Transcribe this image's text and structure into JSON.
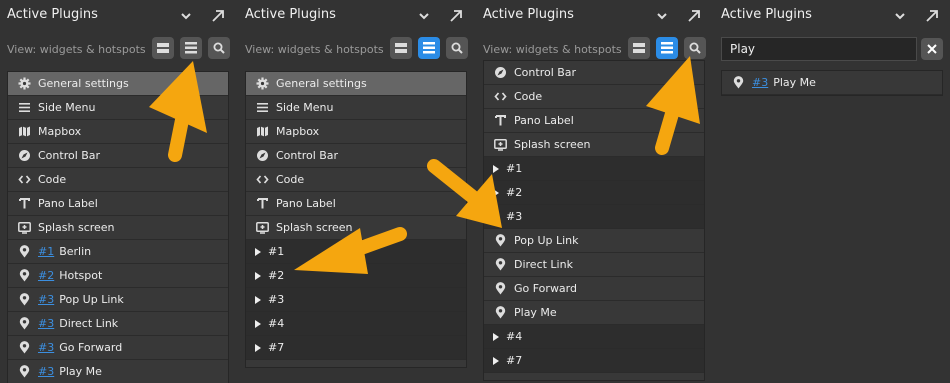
{
  "header": {
    "title": "Active Plugins"
  },
  "toolbar": {
    "view_label": "View: widgets & hotspots"
  },
  "search": {
    "value": "Play"
  },
  "icons": {
    "expand": "expand-arrow-icon",
    "chevron": "chevron-down-icon",
    "search": "search-icon",
    "collapse": "collapse-all-icon",
    "list": "expand-all-icon",
    "clear": "close-icon"
  },
  "colors": {
    "active_button": "#2b8ce6",
    "link": "#3c8fe0",
    "annotation_arrow": "#f5a60f",
    "selected_row": "#666666"
  },
  "panel1": {
    "items": [
      {
        "icon": "gear",
        "label": "General settings"
      },
      {
        "icon": "menu",
        "label": "Side Menu"
      },
      {
        "icon": "map",
        "label": "Mapbox"
      },
      {
        "icon": "compass",
        "label": "Control Bar"
      },
      {
        "icon": "code",
        "label": "Code"
      },
      {
        "icon": "text",
        "label": "Pano Label"
      },
      {
        "icon": "splash",
        "label": "Splash screen"
      },
      {
        "icon": "pin",
        "tag": "#1",
        "label": "Berlin"
      },
      {
        "icon": "pin",
        "tag": "#2",
        "label": "Hotspot"
      },
      {
        "icon": "pin",
        "tag": "#3",
        "label": "Pop Up Link"
      },
      {
        "icon": "pin",
        "tag": "#3",
        "label": "Direct Link"
      },
      {
        "icon": "pin",
        "tag": "#3",
        "label": "Go Forward"
      },
      {
        "icon": "pin",
        "tag": "#3",
        "label": "Play Me"
      }
    ]
  },
  "panel2": {
    "items": [
      {
        "icon": "gear",
        "label": "General settings"
      },
      {
        "icon": "menu",
        "label": "Side Menu"
      },
      {
        "icon": "map",
        "label": "Mapbox"
      },
      {
        "icon": "compass",
        "label": "Control Bar"
      },
      {
        "icon": "code",
        "label": "Code"
      },
      {
        "icon": "text",
        "label": "Pano Label"
      },
      {
        "icon": "splash",
        "label": "Splash screen"
      },
      {
        "group": true,
        "label": "#1"
      },
      {
        "group": true,
        "label": "#2"
      },
      {
        "group": true,
        "label": "#3"
      },
      {
        "group": true,
        "label": "#4"
      },
      {
        "group": true,
        "label": "#7"
      }
    ]
  },
  "panel3": {
    "items": [
      {
        "icon": "compass",
        "label": "Control Bar"
      },
      {
        "icon": "code",
        "label": "Code"
      },
      {
        "icon": "text",
        "label": "Pano Label"
      },
      {
        "icon": "splash",
        "label": "Splash screen"
      },
      {
        "group": true,
        "label": "#1"
      },
      {
        "group": true,
        "label": "#2"
      },
      {
        "group": true,
        "label": "#3"
      },
      {
        "icon": "pin",
        "label": "Pop Up Link"
      },
      {
        "icon": "pin",
        "label": "Direct Link"
      },
      {
        "icon": "pin",
        "label": "Go Forward"
      },
      {
        "icon": "pin",
        "label": "Play Me"
      },
      {
        "group": true,
        "label": "#4"
      },
      {
        "group": true,
        "label": "#7"
      }
    ]
  },
  "results": {
    "items": [
      {
        "icon": "pin",
        "tag": "#3",
        "label": "Play Me"
      }
    ]
  }
}
